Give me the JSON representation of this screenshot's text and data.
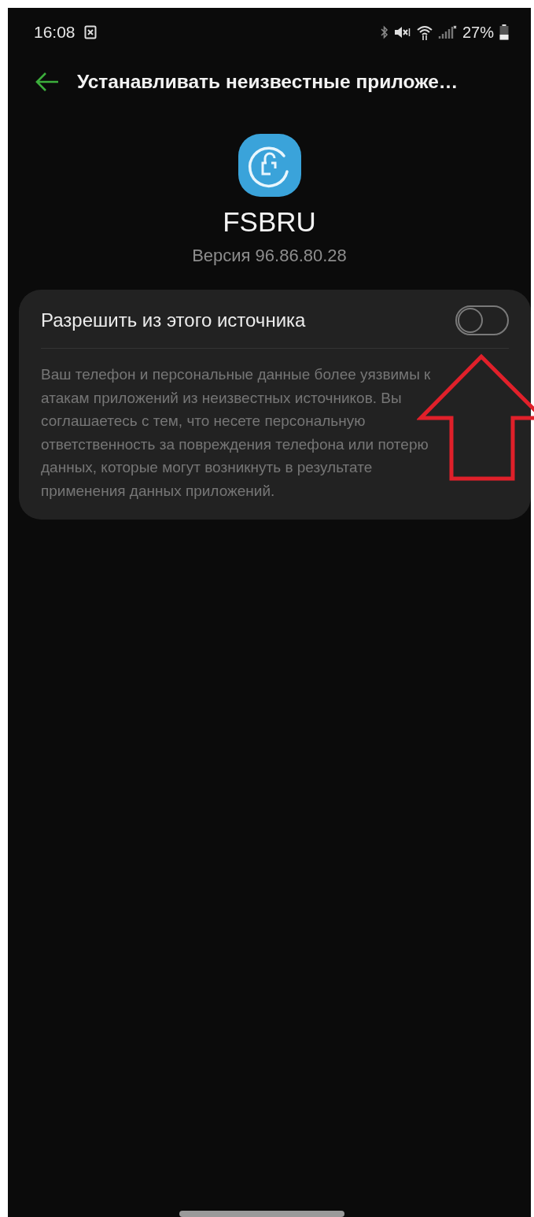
{
  "status_bar": {
    "time": "16:08",
    "battery": "27%"
  },
  "header": {
    "title": "Устанавливать неизвестные приложе…"
  },
  "app": {
    "name": "FSBRU",
    "version": "Версия 96.86.80.28"
  },
  "setting": {
    "label": "Разрешить из этого источника",
    "on": false,
    "description": "Ваш телефон и персональные данные более уязвимы к атакам приложений из неизвестных источников. Вы соглашаетесь с тем, что несете персональную ответственность за повреждения телефона или потерю данных, которые могут возникнуть в результате применения данных приложений."
  }
}
